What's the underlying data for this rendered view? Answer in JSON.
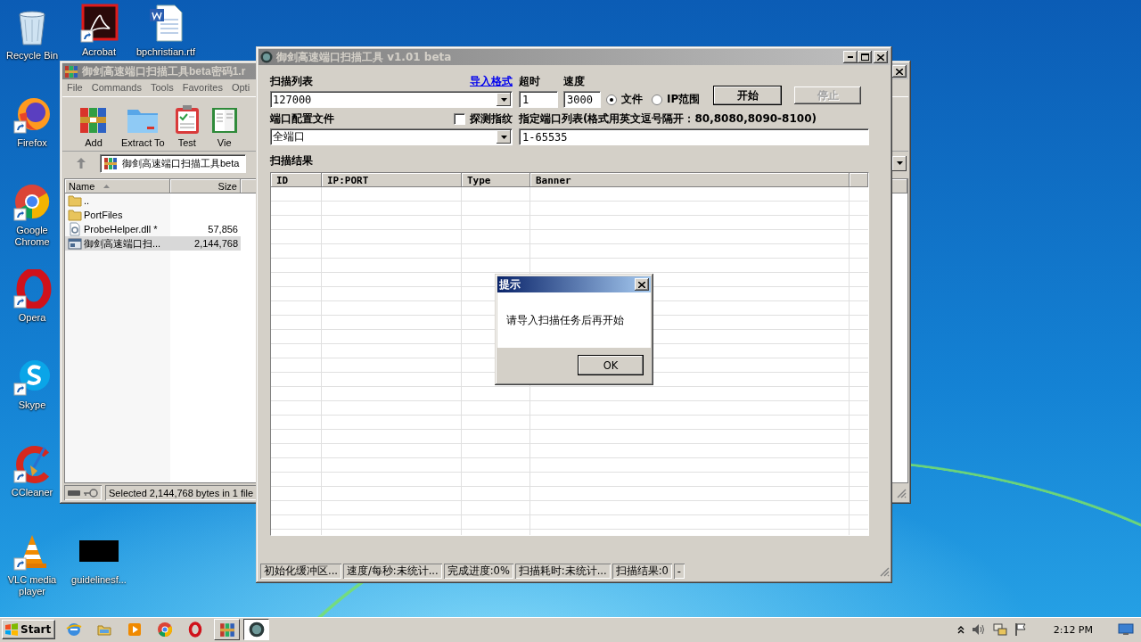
{
  "desktop_icons": [
    {
      "label": "Recycle Bin",
      "kind": "recycle",
      "shortcut": false
    },
    {
      "label": "Acrobat",
      "kind": "pdf",
      "shortcut": true
    },
    {
      "label": "bpchristian.rtf",
      "kind": "doc",
      "shortcut": false
    },
    {
      "label": "Firefox",
      "kind": "firefox",
      "shortcut": true
    },
    {
      "label": "Google Chrome",
      "kind": "chrome",
      "shortcut": true
    },
    {
      "label": "Opera",
      "kind": "opera",
      "shortcut": true
    },
    {
      "label": "Skype",
      "kind": "skype",
      "shortcut": true
    },
    {
      "label": "CCleaner",
      "kind": "ccleaner",
      "shortcut": true
    },
    {
      "label": "VLC media player",
      "kind": "vlc",
      "shortcut": true
    },
    {
      "label": "guidelinesf...",
      "kind": "thumb",
      "shortcut": false
    }
  ],
  "winrar": {
    "title": "御剑高速端口扫描工具beta密码1.r",
    "menu": [
      "File",
      "Commands",
      "Tools",
      "Favorites",
      "Opti"
    ],
    "toolbar": [
      {
        "label": "Add",
        "kind": "add"
      },
      {
        "label": "Extract To",
        "kind": "extract"
      },
      {
        "label": "Test",
        "kind": "test"
      },
      {
        "label": "Vie",
        "kind": "view"
      }
    ],
    "path": "御剑高速端口扫描工具beta",
    "columns": [
      "Name",
      "Size"
    ],
    "files": [
      {
        "name": "..",
        "kind": "folder",
        "selected": false
      },
      {
        "name": "PortFiles",
        "kind": "folder",
        "selected": false
      },
      {
        "name": "ProbeHelper.dll *",
        "size": "57,856",
        "kind": "dll",
        "selected": false
      },
      {
        "name": "御剑高速端口扫...",
        "size": "2,144,768",
        "kind": "exe",
        "selected": true
      }
    ],
    "status": "Selected 2,144,768 bytes in 1 file"
  },
  "scanner": {
    "title": "御剑高速端口扫描工具 v1.01 beta",
    "scan_list": {
      "label": "扫描列表",
      "link": "导入格式",
      "value": "127000"
    },
    "timeout": {
      "label": "超时",
      "value": "1"
    },
    "speed": {
      "label": "速度",
      "value": "3000"
    },
    "mode_options": [
      {
        "label": "文件",
        "selected": true
      },
      {
        "label": "IP范围",
        "selected": false
      }
    ],
    "buttons": [
      {
        "label": "开始",
        "disabled": false
      },
      {
        "label": "停止",
        "disabled": true
      }
    ],
    "port_profile": {
      "label": "端口配置文件",
      "value": "全端口"
    },
    "fingerprint": {
      "label": "探测指纹",
      "checked": false
    },
    "port_list": {
      "label": "指定端口列表(格式用英文逗号隔开：80,8080,8090-8100)",
      "value": "1-65535"
    },
    "results": {
      "label": "扫描结果",
      "columns": [
        "ID",
        "IP:PORT",
        "Type",
        "Banner"
      ]
    },
    "status_bar": [
      "初始化缓冲区...",
      "速度/每秒:未统计...",
      "完成进度:0%",
      "扫描耗时:未统计...",
      "扫描结果:0",
      "-"
    ]
  },
  "dialog": {
    "title": "提示",
    "message": "请导入扫描任务后再开始",
    "button": "OK"
  },
  "taskbar": {
    "start": "Start",
    "windows": [
      {
        "kind": "winrar",
        "selected": false
      },
      {
        "kind": "scanner",
        "selected": true
      }
    ],
    "clock": "2:12 PM"
  }
}
